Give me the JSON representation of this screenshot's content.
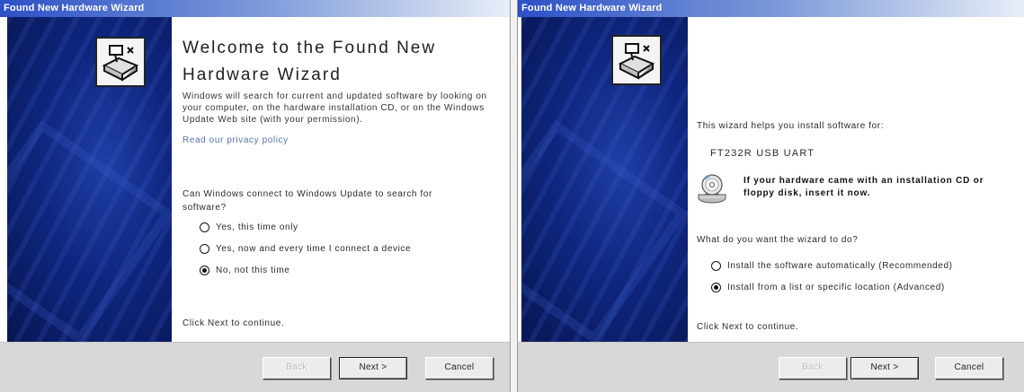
{
  "left_wizard": {
    "title": "Found New Hardware Wizard",
    "heading": "Welcome to the Found New Hardware Wizard",
    "intro": "Windows will search for current and updated software by looking on your computer, on the hardware installation CD, or on the Windows Update Web site (with your permission).",
    "privacy_link": "Read our privacy policy",
    "question": "Can Windows connect to Windows Update to search for software?",
    "options": [
      {
        "label": "Yes, this time only",
        "selected": false
      },
      {
        "label": "Yes, now and every time I connect a device",
        "selected": false
      },
      {
        "label": "No, not this time",
        "selected": true
      }
    ],
    "footer": "Click Next to continue.",
    "buttons": {
      "back": "Back",
      "next": "Next >",
      "cancel": "Cancel"
    }
  },
  "right_wizard": {
    "title": "Found New Hardware Wizard",
    "helps_text": "This wizard helps you install software for:",
    "device_name": "FT232R USB UART",
    "cd_note": "If your hardware came with an installation CD or floppy disk, insert it now.",
    "question": "What do you want the wizard to do?",
    "options": [
      {
        "label": "Install the software automatically (Recommended)",
        "selected": false
      },
      {
        "label": "Install from a list or specific location (Advanced)",
        "selected": true
      }
    ],
    "footer": "Click Next to continue.",
    "buttons": {
      "back": "Back",
      "next": "Next >",
      "cancel": "Cancel"
    }
  },
  "icons": {
    "hardware": "hardware-wizard-icon",
    "cd": "cd-drive-icon",
    "radio": "radio-button-icon"
  },
  "colors": {
    "title_bar": "#2c50c6",
    "banner": "#0f2780",
    "link": "#5573b0",
    "button_bar": "#d8d8d8"
  }
}
